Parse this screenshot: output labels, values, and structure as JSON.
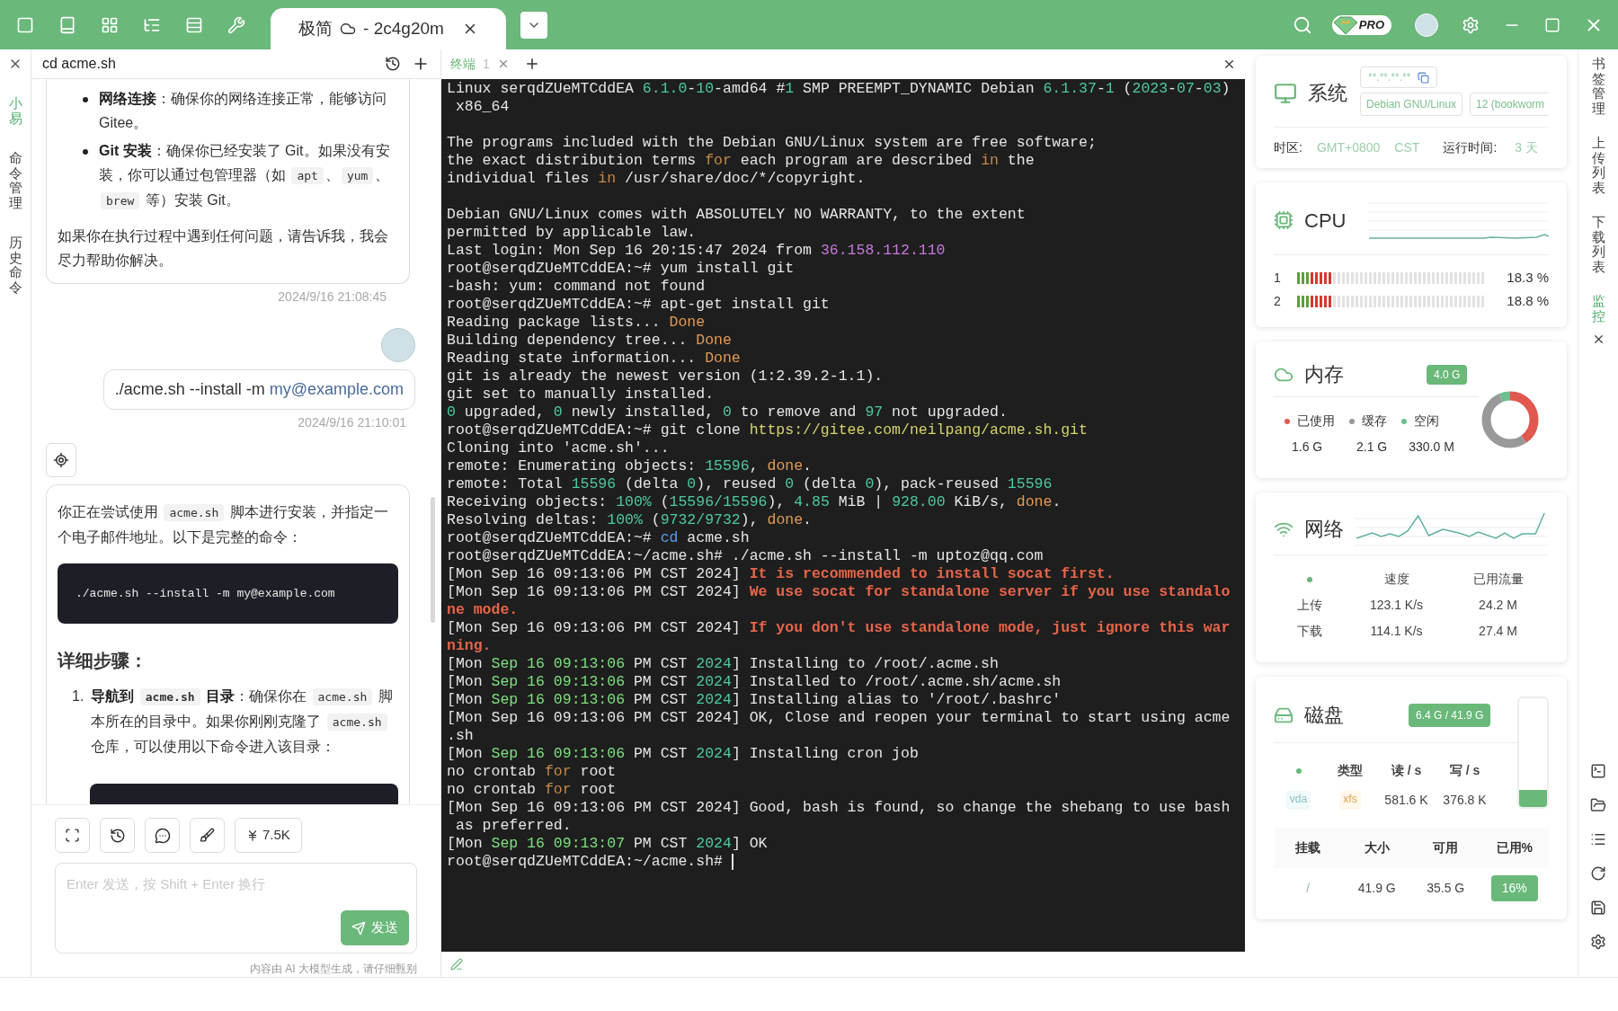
{
  "title_bar": {
    "tab": {
      "name": "极简",
      "host": "- 2c4g20m",
      "selected": true
    },
    "plan_badge": "PRO"
  },
  "side_tabs": [
    {
      "label": "小易",
      "selected": true
    },
    {
      "label": "命令管理",
      "selected": false
    },
    {
      "label": "历史命令",
      "selected": false
    }
  ],
  "chat": {
    "title": "cd acme.sh",
    "messages": [
      {
        "kind": "assistant",
        "cut_top": true,
        "blocks": [
          {
            "kind": "bullets",
            "items": [
              [
                {
                  "text": "网络连接",
                  "kind": "bold"
                },
                {
                  "text": "：确保你的网络连接正常，能够访问 Gitee。",
                  "kind": "plain"
                }
              ],
              [
                {
                  "text": "Git 安装",
                  "kind": "bold"
                },
                {
                  "text": "：确保你已经安装了 Git。如果没有安装，你可以通过包管理器（如 ",
                  "kind": "plain"
                },
                {
                  "text": "apt",
                  "kind": "code"
                },
                {
                  "text": "、",
                  "kind": "plain"
                },
                {
                  "text": "yum",
                  "kind": "code"
                },
                {
                  "text": "、",
                  "kind": "plain"
                },
                {
                  "text": "brew",
                  "kind": "code"
                },
                {
                  "text": " 等）安装 Git。",
                  "kind": "plain"
                }
              ]
            ]
          },
          {
            "kind": "paragraph",
            "segments": [
              {
                "text": "如果你在执行过程中遇到任何问题，请告诉我，我会尽力帮助你解决。",
                "kind": "plain"
              }
            ]
          }
        ],
        "time": "2024/9/16 21:08:45"
      },
      {
        "kind": "user",
        "text": "./acme.sh --install -m ",
        "link": "my@example.com",
        "time": "2024/9/16 21:10:01"
      },
      {
        "kind": "assistant",
        "cut_top": false,
        "blocks": [
          {
            "kind": "paragraph",
            "segments": [
              {
                "text": "你正在尝试使用 ",
                "kind": "plain"
              },
              {
                "text": "acme.sh",
                "kind": "code"
              },
              {
                "text": " 脚本进行安装，并指定一个电子邮件地址。以下是完整的命令：",
                "kind": "plain"
              }
            ]
          },
          {
            "kind": "code",
            "text": "./acme.sh --install -m my@example.com"
          },
          {
            "kind": "heading",
            "text": "详细步骤："
          },
          {
            "kind": "steps",
            "items": [
              {
                "number": "1.",
                "segments": [
                  {
                    "text": "导航到 ",
                    "kind": "bold"
                  },
                  {
                    "text": "acme.sh",
                    "kind": "boldcode"
                  },
                  {
                    "text": " 目录",
                    "kind": "bold"
                  },
                  {
                    "text": "：确保你在 ",
                    "kind": "plain"
                  },
                  {
                    "text": "acme.sh",
                    "kind": "code"
                  },
                  {
                    "text": " 脚本所在的目录中。如果你刚刚克隆了 ",
                    "kind": "plain"
                  },
                  {
                    "text": "acme.sh",
                    "kind": "code"
                  },
                  {
                    "text": " 仓库，可以使用以下命令进入该目录：",
                    "kind": "plain"
                  }
                ]
              }
            ]
          },
          {
            "kind": "code_cut"
          }
        ]
      }
    ],
    "token_count": "7.5K",
    "input": {
      "placeholder": "Enter 发送，按 Shift + Enter 换行"
    },
    "send_label": "发送",
    "disclaimer": "内容由 AI 大模型生成，请仔细甄别"
  },
  "terminal": {
    "tabs": [
      {
        "label": "终端",
        "number": "1",
        "selected": true
      }
    ],
    "lines": [
      {
        "segments": [
          {
            "text": "Linux serqdZUeMTCddEA "
          },
          {
            "text": "6.1.0",
            "kind": "num"
          },
          {
            "text": "-"
          },
          {
            "text": "10",
            "kind": "num"
          },
          {
            "text": "-amd64 #"
          },
          {
            "text": "1",
            "kind": "num"
          },
          {
            "text": " SMP PREEMPT_DYNAMIC Debian "
          },
          {
            "text": "6.1.37",
            "kind": "num"
          },
          {
            "text": "-"
          },
          {
            "text": "1",
            "kind": "num"
          },
          {
            "text": " ("
          },
          {
            "text": "2023",
            "kind": "num"
          },
          {
            "text": "-"
          },
          {
            "text": "07",
            "kind": "num"
          },
          {
            "text": "-"
          },
          {
            "text": "03",
            "kind": "num"
          },
          {
            "text": ")"
          }
        ]
      },
      {
        "segments": [
          {
            "text": " x86_64"
          }
        ]
      },
      {
        "blank_before": true,
        "segments": [
          {
            "text": "The programs included with the Debian GNU/Linux system are free software;"
          }
        ]
      },
      {
        "segments": [
          {
            "text": "the exact distribution terms "
          },
          {
            "text": "for",
            "kind": "kw"
          },
          {
            "text": " each program are described "
          },
          {
            "text": "in",
            "kind": "kw"
          },
          {
            "text": " the"
          }
        ]
      },
      {
        "segments": [
          {
            "text": "individual files "
          },
          {
            "text": "in",
            "kind": "kw"
          },
          {
            "text": " /usr/share/doc/*/copyright."
          }
        ]
      },
      {
        "blank_before": true,
        "segments": [
          {
            "text": "Debian GNU/Linux comes with ABSOLUTELY NO WARRANTY, to the extent"
          }
        ]
      },
      {
        "segments": [
          {
            "text": "permitted by applicable law."
          }
        ]
      },
      {
        "segments": [
          {
            "text": "Last login: Mon Sep 16 20:15:47 2024 from "
          },
          {
            "text": "36.158.112.110",
            "kind": "ip"
          }
        ]
      },
      {
        "segments": [
          {
            "text": "root@serqdZUeMTCddEA:~# yum install git"
          }
        ]
      },
      {
        "segments": [
          {
            "text": "-bash: yum: command not found"
          }
        ]
      },
      {
        "segments": [
          {
            "text": "root@serqdZUeMTCddEA:~# apt-get install git"
          }
        ]
      },
      {
        "segments": [
          {
            "text": "Reading package lists... "
          },
          {
            "text": "Done",
            "kind": "ok"
          }
        ]
      },
      {
        "segments": [
          {
            "text": "Building dependency tree... "
          },
          {
            "text": "Done",
            "kind": "ok"
          }
        ]
      },
      {
        "segments": [
          {
            "text": "Reading state information... "
          },
          {
            "text": "Done",
            "kind": "ok"
          }
        ]
      },
      {
        "segments": [
          {
            "text": "git is already the newest version (1:2.39.2-1.1)."
          }
        ]
      },
      {
        "segments": [
          {
            "text": "git set to manually installed."
          }
        ]
      },
      {
        "segments": [
          {
            "text": "0",
            "kind": "num"
          },
          {
            "text": " upgraded, "
          },
          {
            "text": "0",
            "kind": "num"
          },
          {
            "text": " newly installed, "
          },
          {
            "text": "0",
            "kind": "num"
          },
          {
            "text": " to remove and "
          },
          {
            "text": "97",
            "kind": "num"
          },
          {
            "text": " not upgraded."
          }
        ]
      },
      {
        "segments": [
          {
            "text": "root@serqdZUeMTCddEA:~# git clone "
          },
          {
            "text": "https://gitee.com/neilpang/acme.sh.git",
            "kind": "url"
          }
        ]
      },
      {
        "segments": [
          {
            "text": "Cloning into 'acme.sh'..."
          }
        ]
      },
      {
        "segments": [
          {
            "text": "remote: Enumerating objects: "
          },
          {
            "text": "15596",
            "kind": "num"
          },
          {
            "text": ", "
          },
          {
            "text": "done",
            "kind": "ok"
          },
          {
            "text": "."
          }
        ]
      },
      {
        "segments": [
          {
            "text": "remote: Total "
          },
          {
            "text": "15596",
            "kind": "num"
          },
          {
            "text": " (delta "
          },
          {
            "text": "0",
            "kind": "num"
          },
          {
            "text": "), reused "
          },
          {
            "text": "0",
            "kind": "num"
          },
          {
            "text": " (delta "
          },
          {
            "text": "0",
            "kind": "num"
          },
          {
            "text": "), pack-reused "
          },
          {
            "text": "15596",
            "kind": "num"
          }
        ]
      },
      {
        "segments": [
          {
            "text": "Receiving objects: "
          },
          {
            "text": "100%",
            "kind": "num"
          },
          {
            "text": " ("
          },
          {
            "text": "15596/15596",
            "kind": "num"
          },
          {
            "text": "), "
          },
          {
            "text": "4.85",
            "kind": "num"
          },
          {
            "text": " MiB | "
          },
          {
            "text": "928.00",
            "kind": "num"
          },
          {
            "text": " KiB/s, "
          },
          {
            "text": "done",
            "kind": "ok"
          },
          {
            "text": "."
          }
        ]
      },
      {
        "segments": [
          {
            "text": "Resolving deltas: "
          },
          {
            "text": "100%",
            "kind": "num"
          },
          {
            "text": " ("
          },
          {
            "text": "9732/9732",
            "kind": "num"
          },
          {
            "text": "), "
          },
          {
            "text": "done",
            "kind": "ok"
          },
          {
            "text": "."
          }
        ]
      },
      {
        "segments": [
          {
            "text": "root@serqdZUeMTCddEA:~# "
          },
          {
            "text": "cd",
            "kind": "cmd"
          },
          {
            "text": " acme.sh"
          }
        ]
      },
      {
        "segments": [
          {
            "text": "root@serqdZUeMTCddEA:~/acme.sh# ./acme.sh --install -m uptoz@qq.com"
          }
        ]
      },
      {
        "segments": [
          {
            "text": "[Mon Sep 16 09:13:06 PM CST 2024] "
          },
          {
            "text": "It is recommended to install socat first.",
            "kind": "warn"
          }
        ]
      },
      {
        "segments": [
          {
            "text": "[Mon Sep 16 09:13:06 PM CST 2024] "
          },
          {
            "text": "We use socat for standalone server if you use standalo",
            "kind": "warn"
          }
        ]
      },
      {
        "segments": [
          {
            "text": "ne mode.",
            "kind": "warn"
          }
        ]
      },
      {
        "segments": [
          {
            "text": "[Mon Sep 16 09:13:06 PM CST 2024] "
          },
          {
            "text": "If you don't use standalone mode, just ignore this war",
            "kind": "warn"
          }
        ]
      },
      {
        "segments": [
          {
            "text": "ning.",
            "kind": "warn"
          }
        ]
      },
      {
        "segments": [
          {
            "text": "[Mon "
          },
          {
            "text": "Sep 16 09:13:06",
            "kind": "date"
          },
          {
            "text": " PM CST "
          },
          {
            "text": "2024",
            "kind": "num"
          },
          {
            "text": "] Installing to /root/.acme.sh"
          }
        ]
      },
      {
        "segments": [
          {
            "text": "[Mon "
          },
          {
            "text": "Sep 16 09:13:06",
            "kind": "date"
          },
          {
            "text": " PM CST "
          },
          {
            "text": "2024",
            "kind": "num"
          },
          {
            "text": "] Installed to /root/.acme.sh/acme.sh"
          }
        ]
      },
      {
        "segments": [
          {
            "text": "[Mon "
          },
          {
            "text": "Sep 16 09:13:06",
            "kind": "date"
          },
          {
            "text": " PM CST "
          },
          {
            "text": "2024",
            "kind": "num"
          },
          {
            "text": "] Installing alias to '/root/.bashrc'"
          }
        ]
      },
      {
        "segments": [
          {
            "text": "[Mon Sep 16 09:13:06 PM CST 2024] OK, Close and reopen your terminal to start using acme"
          }
        ]
      },
      {
        "segments": [
          {
            "text": ".sh"
          }
        ]
      },
      {
        "segments": [
          {
            "text": "[Mon "
          },
          {
            "text": "Sep 16 09:13:06",
            "kind": "date"
          },
          {
            "text": " PM CST "
          },
          {
            "text": "2024",
            "kind": "num"
          },
          {
            "text": "] Installing cron job"
          }
        ]
      },
      {
        "segments": [
          {
            "text": "no crontab "
          },
          {
            "text": "for",
            "kind": "kw"
          },
          {
            "text": " root"
          }
        ]
      },
      {
        "segments": [
          {
            "text": "no crontab "
          },
          {
            "text": "for",
            "kind": "kw"
          },
          {
            "text": " root"
          }
        ]
      },
      {
        "segments": [
          {
            "text": "[Mon Sep 16 09:13:06 PM CST 2024] Good, bash is found, so change the shebang to use bash"
          }
        ]
      },
      {
        "segments": [
          {
            "text": " as preferred."
          }
        ]
      },
      {
        "segments": [
          {
            "text": "[Mon "
          },
          {
            "text": "Sep 16 09:13:07",
            "kind": "date"
          },
          {
            "text": " PM CST "
          },
          {
            "text": "2024",
            "kind": "num"
          },
          {
            "text": "] OK"
          }
        ]
      },
      {
        "cursor": true,
        "segments": [
          {
            "text": "root@serqdZUeMTCddEA:~/acme.sh# "
          }
        ]
      }
    ]
  },
  "monitor": {
    "system": {
      "title": "系统",
      "ip": "**.**.**.**",
      "os": "Debian GNU/Linux",
      "version": "12 (bookworm",
      "timezone_label": "时区:",
      "timezone": "GMT+0800",
      "zone": "CST",
      "uptime_label": "运行时间:",
      "uptime": "3 天"
    },
    "cpu": {
      "title": "CPU",
      "cores": [
        {
          "name": "1",
          "level": 0.183,
          "reading": "18.3 %"
        },
        {
          "name": "2",
          "level": 0.188,
          "reading": "18.8 %"
        }
      ]
    },
    "memory": {
      "title": "内存",
      "total": "4.0 G",
      "legend": [
        {
          "label": "已使用",
          "value": "1.6 G",
          "color": "#e0584f"
        },
        {
          "label": "缓存",
          "value": "2.1 G",
          "color": "#999999"
        },
        {
          "label": "空闲",
          "value": "330.0 M",
          "color": "#6cc08b"
        }
      ]
    },
    "network": {
      "title": "网络",
      "columns": [
        "速度",
        "已用流量"
      ],
      "rows": [
        {
          "label": "上传",
          "speed": "123.1 K/s",
          "used": "24.2 M"
        },
        {
          "label": "下载",
          "speed": "114.1 K/s",
          "used": "27.4 M"
        }
      ]
    },
    "disk": {
      "title": "磁盘",
      "usage": "6.4 G / 41.9 G",
      "level": 0.16,
      "io_columns": [
        "类型",
        "读 / s",
        "写 / s"
      ],
      "devices": [
        {
          "name": "vda",
          "type": "xfs",
          "read": "581.6 K",
          "write": "376.8 K"
        }
      ],
      "mount_columns": [
        "挂载",
        "大小",
        "可用",
        "已用%"
      ],
      "mounts": [
        {
          "path": "/",
          "size": "41.9 G",
          "free": "35.5 G",
          "used": "16%"
        }
      ]
    }
  },
  "right_tabs": [
    {
      "label": "书签管理",
      "selected": false
    },
    {
      "label": "上传列表",
      "selected": false
    },
    {
      "label": "下载列表",
      "selected": false
    },
    {
      "label": "监控",
      "selected": true
    }
  ]
}
